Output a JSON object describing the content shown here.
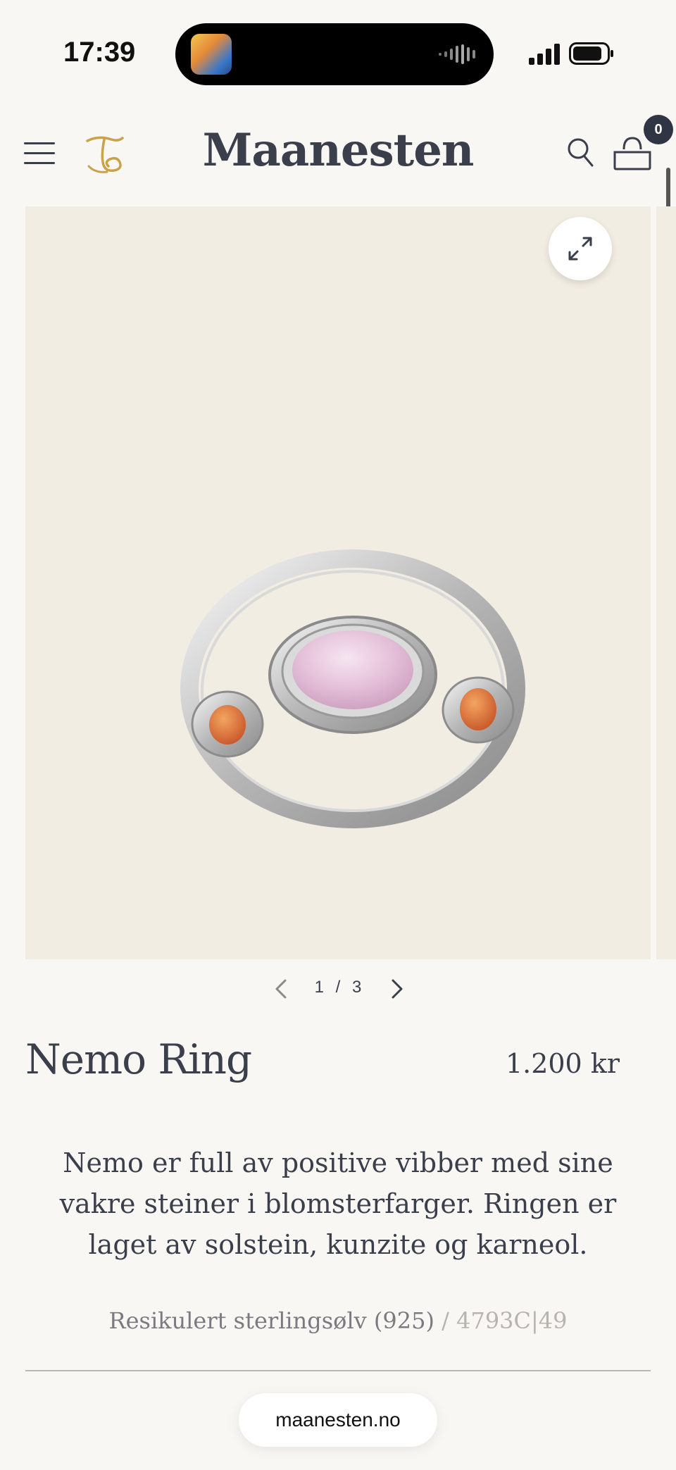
{
  "status_bar": {
    "time": "17:39"
  },
  "header": {
    "brand": "Maanesten",
    "cart_count": "0",
    "icons": [
      "menu-icon",
      "logo-mark",
      "search-icon",
      "cart-icon"
    ]
  },
  "gallery": {
    "current": "1",
    "separator": "/",
    "total": "3",
    "pager_label": "1 / 3",
    "accent_background": "#f2ede3"
  },
  "product": {
    "title": "Nemo Ring",
    "price": "1.200 kr",
    "description": "Nemo er full av positive vibber med sine vakre steiner i blomsterfarger. Ringen er laget av solstein, kunzite og karneol.",
    "material": "Resikulert sterlingsølv (925)",
    "meta_separator": " / ",
    "sku": "4793C|49"
  },
  "browser": {
    "url": "maanesten.no"
  },
  "colors": {
    "text": "#3a3f4b",
    "page_bg": "#f8f7f4",
    "badge_bg": "#2f3542"
  }
}
